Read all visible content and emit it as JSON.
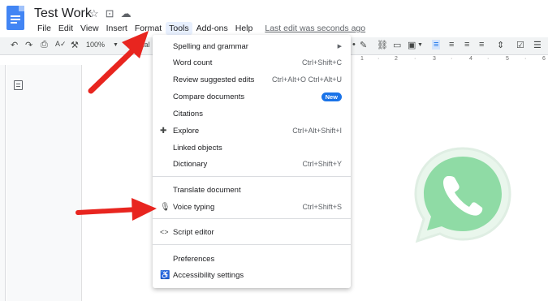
{
  "header": {
    "title": "Test Work",
    "title_icons": [
      "star-icon",
      "move-folder-icon",
      "cloud-status-icon"
    ]
  },
  "menubar": {
    "items": [
      "File",
      "Edit",
      "View",
      "Insert",
      "Format",
      "Tools",
      "Add-ons",
      "Help"
    ],
    "active": "Tools",
    "last_edit": "Last edit was seconds ago"
  },
  "toolbar": {
    "zoom": "100%",
    "style_snippet": "mal"
  },
  "ruler": {
    "ticks": [
      "·",
      "1",
      "·",
      "2",
      "·",
      "3",
      "·",
      "4",
      "·",
      "5",
      "·",
      "6"
    ]
  },
  "tools_menu": {
    "items": [
      {
        "label": "Spelling and grammar",
        "shortcut": "",
        "submenu": true
      },
      {
        "label": "Word count",
        "shortcut": "Ctrl+Shift+C"
      },
      {
        "label": "Review suggested edits",
        "shortcut": "Ctrl+Alt+O Ctrl+Alt+U"
      },
      {
        "label": "Compare documents",
        "badge": "New"
      },
      {
        "label": "Citations",
        "shortcut": ""
      },
      {
        "label": "Explore",
        "shortcut": "Ctrl+Alt+Shift+I",
        "icon": "explore-icon"
      },
      {
        "label": "Linked objects",
        "shortcut": ""
      },
      {
        "label": "Dictionary",
        "shortcut": "Ctrl+Shift+Y"
      },
      {
        "label": "Translate document",
        "shortcut": ""
      },
      {
        "label": "Voice typing",
        "shortcut": "Ctrl+Shift+S",
        "icon": "microphone-icon"
      },
      {
        "label": "Script editor",
        "shortcut": "",
        "icon": "code-icon"
      },
      {
        "label": "Preferences",
        "shortcut": ""
      },
      {
        "label": "Accessibility settings",
        "shortcut": "",
        "icon": "accessibility-icon"
      }
    ]
  },
  "colors": {
    "accent": "#1a73e8",
    "arrow": "#e8251f",
    "docs_blue": "#4285f4",
    "whatsapp_green": "#25d366"
  }
}
